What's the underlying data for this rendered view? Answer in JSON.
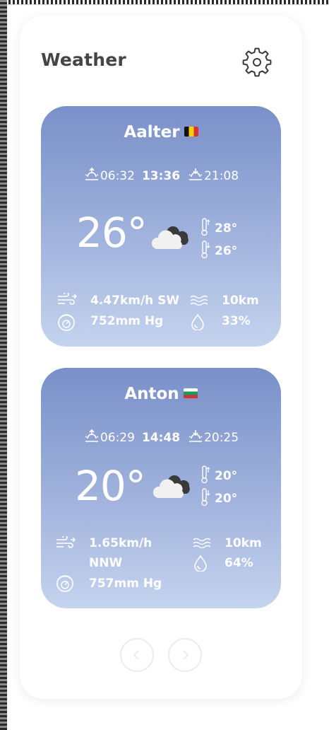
{
  "app": {
    "title": "Weather",
    "settings_icon": "gear-icon"
  },
  "cards": [
    {
      "city": "Aalter",
      "flag": "belgium-flag-icon",
      "sunrise": "06:32",
      "noon": "13:36",
      "sunset": "21:08",
      "temperature": "26°",
      "condition_icon": "cloudy-icon",
      "temp_max": "28°",
      "temp_min": "26°",
      "wind": "4.47km/h SW",
      "visibility": "10km",
      "pressure": "752mm Hg",
      "humidity": "33%"
    },
    {
      "city": "Anton",
      "flag": "bulgaria-flag-icon",
      "sunrise": "06:29",
      "noon": "14:48",
      "sunset": "20:25",
      "temperature": "20°",
      "condition_icon": "cloudy-icon",
      "temp_max": "20°",
      "temp_min": "20°",
      "wind_line1": "1.65km/h",
      "wind_line2": "NNW",
      "visibility": "10km",
      "pressure": "757mm Hg",
      "humidity": "64%"
    }
  ],
  "navigation": {
    "prev_icon": "chevron-left-icon",
    "next_icon": "chevron-right-icon"
  },
  "colors": {
    "card_top": "#7990c8",
    "card_bottom": "#c5d3ee",
    "title": "#454545"
  }
}
